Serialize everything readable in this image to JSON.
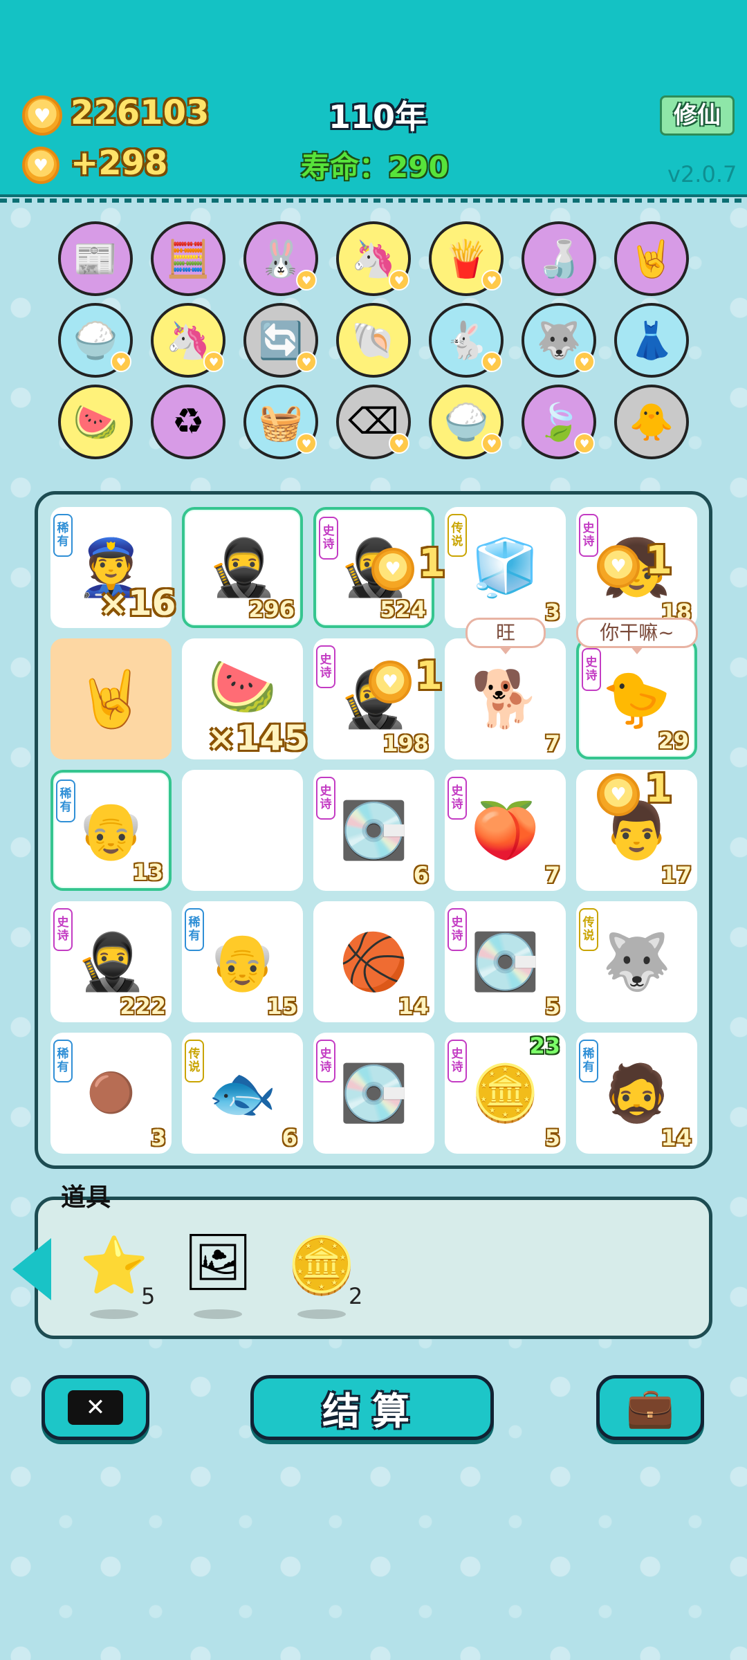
{
  "header": {
    "coins": "226103",
    "income": "+298",
    "year": "110年",
    "lifespan": "寿命：290",
    "xiuxian_label": "修仙",
    "version": "v2.0.7"
  },
  "collection": [
    "time-magazine",
    "math-person",
    "bunny",
    "unicorn",
    "fries",
    "milk-jar",
    "rock-hand",
    "rice-bowl",
    "unicorn",
    "recycle-arrows",
    "shell",
    "bunny",
    "husky",
    "skirt",
    "fruit-basket",
    "recycle",
    "fruit-basket",
    "delete-key",
    "rice-bowl",
    "leaf",
    "chick-egg"
  ],
  "board": [
    {
      "tag": "稀有",
      "icon": "police-face",
      "mult": "×16"
    },
    {
      "tag": "",
      "icon": "bandit-face",
      "num": "296"
    },
    {
      "tag": "史诗",
      "icon": "bandit-face",
      "num": "524",
      "coin_bonus": "1"
    },
    {
      "tag": "传说",
      "icon": "fridge",
      "num": "3"
    },
    {
      "tag": "史诗",
      "icon": "girl",
      "num": "18",
      "coin_bonus": "1"
    },
    {
      "tag": "",
      "icon": "rock-hand"
    },
    {
      "tag": "",
      "icon": "watermelon",
      "mult": "×145"
    },
    {
      "tag": "史诗",
      "icon": "bandit-face",
      "num": "198",
      "coin_bonus": "1"
    },
    {
      "tag": "",
      "icon": "dog",
      "num": "7",
      "bubble": "旺"
    },
    {
      "tag": "史诗",
      "icon": "chick-mop",
      "num": "29",
      "bubble": "你干嘛~"
    },
    {
      "tag": "稀有",
      "icon": "bald-man",
      "num": "13"
    },
    {
      "tag": "",
      "icon": ""
    },
    {
      "tag": "史诗",
      "icon": "gpu",
      "num": "6"
    },
    {
      "tag": "史诗",
      "icon": "peach",
      "num": "7"
    },
    {
      "tag": "",
      "icon": "man-face",
      "num": "17",
      "coin_bonus": "1"
    },
    {
      "tag": "史诗",
      "icon": "bandit-face",
      "num": "222"
    },
    {
      "tag": "稀有",
      "icon": "bald-man",
      "num": "15"
    },
    {
      "tag": "",
      "icon": "basketball-man",
      "num": "14"
    },
    {
      "tag": "史诗",
      "icon": "gpu",
      "num": "5"
    },
    {
      "tag": "传说",
      "icon": "king-husky"
    },
    {
      "tag": "稀有",
      "icon": "orange",
      "num": "3"
    },
    {
      "tag": "传说",
      "icon": "koi-fish",
      "num": "6"
    },
    {
      "tag": "史诗",
      "icon": "gpu",
      "num": ""
    },
    {
      "tag": "史诗",
      "icon": "bitcoin-pie",
      "num": "5",
      "top_num": "23"
    },
    {
      "tag": "稀有",
      "icon": "hat-man",
      "num": "14"
    }
  ],
  "items": {
    "title": "道具",
    "list": [
      {
        "icon": "star",
        "count": "5"
      },
      {
        "icon": "frame",
        "count": ""
      },
      {
        "icon": "dollar-coin",
        "count": "2"
      }
    ]
  },
  "buttons": {
    "settle": "结算"
  }
}
